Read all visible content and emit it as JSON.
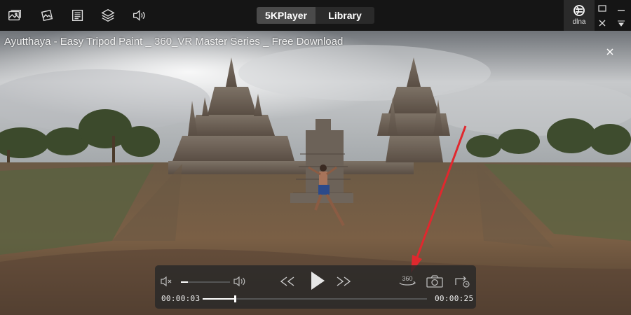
{
  "app": {
    "tabs": [
      {
        "label": "5KPlayer",
        "active": true
      },
      {
        "label": "Library",
        "active": false
      }
    ],
    "dlna_label": "dlna",
    "toolbar_icons": [
      "photo-icon",
      "photo-edit-icon",
      "document-icon",
      "layers-icon",
      "audio-icon"
    ]
  },
  "video": {
    "title": "Ayutthaya - Easy Tripod Paint _ 360_VR Master Series _ Free Download"
  },
  "player": {
    "current_time": "00:00:03",
    "total_time": "00:00:25",
    "progress": 0.14,
    "volume": 0.14,
    "muted": true,
    "mode_360_label": "360"
  },
  "colors": {
    "titlebar_bg": "#151515",
    "tab_active_bg": "#4a4a4a",
    "tab_inactive_bg": "#2a2a2a",
    "annotation_arrow": "#e0282e",
    "control_bar_bg": "#282828"
  }
}
